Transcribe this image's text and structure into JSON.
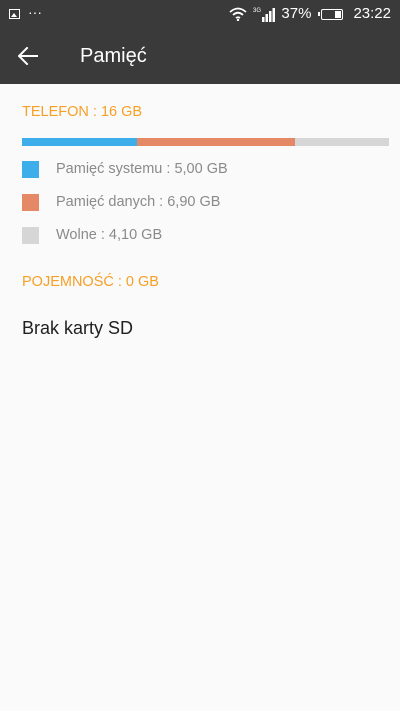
{
  "status_bar": {
    "left_icons": [
      "gallery-icon",
      "more-dots-icon"
    ],
    "more_dots": "···",
    "network_type": "3G",
    "battery_percent_text": "37%",
    "battery_level": 0.37,
    "time": "23:22"
  },
  "toolbar": {
    "back_icon": "arrow-back-icon",
    "title": "Pamięć"
  },
  "phone": {
    "header": "TELEFON : 16 GB",
    "usage": [
      {
        "label": "Pamięć systemu : 5,00 GB",
        "gb": 5.0,
        "color": "#3daee9"
      },
      {
        "label": "Pamięć danych : 6,90 GB",
        "gb": 6.9,
        "color": "#e58866"
      },
      {
        "label": "Wolne : 4,10 GB",
        "gb": 4.1,
        "color": "#d6d6d6"
      }
    ]
  },
  "sd_card": {
    "header": "POJEMNOŚĆ : 0 GB",
    "status": "Brak karty SD"
  },
  "colors": {
    "accent": "#f5a025",
    "bar_background": "#3a3a3a"
  }
}
